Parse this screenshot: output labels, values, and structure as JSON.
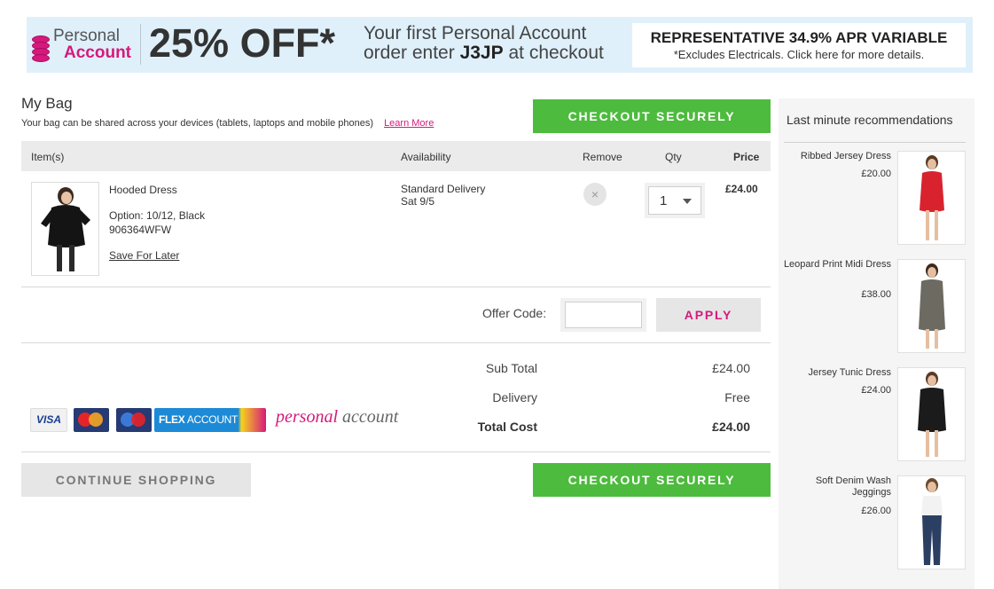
{
  "banner": {
    "logo_line1": "Personal",
    "logo_line2": "Account",
    "offer": "25% OFF*",
    "desc_line1": "Your first Personal Account",
    "desc_line2_pre": "order enter",
    "desc_code": "J3JP",
    "desc_line2_post": "at checkout",
    "apr": "REPRESENTATIVE 34.9% APR VARIABLE",
    "apr_note": "*Excludes Electricals. Click here for more details.",
    "colors": {
      "bg": "#dff0fb",
      "brand_pink": "#d6197c"
    }
  },
  "bag": {
    "title": "My Bag",
    "subtitle": "Your bag can be shared across your devices (tablets, laptops and mobile phones)",
    "learn_more": "Learn More"
  },
  "checkout_label": "CHECKOUT SECURELY",
  "table": {
    "headers": {
      "items": "Item(s)",
      "availability": "Availability",
      "remove": "Remove",
      "qty": "Qty",
      "price": "Price"
    },
    "items": [
      {
        "name": "Hooded Dress",
        "option": "Option: 10/12, Black",
        "code": "906364WFW",
        "save_for_later": "Save For Later",
        "delivery": "Standard Delivery",
        "delivery_date": "Sat 9/5",
        "remove_icon": "×",
        "qty": "1",
        "price": "£24.00"
      }
    ]
  },
  "offer": {
    "label": "Offer Code:",
    "value": "",
    "apply": "APPLY"
  },
  "totals": {
    "subtotal_label": "Sub Total",
    "subtotal": "£24.00",
    "delivery_label": "Delivery",
    "delivery": "Free",
    "total_label": "Total Cost",
    "total": "£24.00"
  },
  "payment": {
    "visa": "VISA",
    "flex_bold": "FLEX",
    "flex_rest": "ACCOUNT",
    "pa_word1": "personal",
    "pa_word2": "account"
  },
  "continue_label": "CONTINUE SHOPPING",
  "recommendations": {
    "title": "Last minute recommendations",
    "items": [
      {
        "name": "Ribbed Jersey Dress",
        "price": "£20.00",
        "color": "#d8232f"
      },
      {
        "name": "Leopard Print Midi Dress",
        "price": "£38.00",
        "color": "#6d6a62"
      },
      {
        "name": "Jersey Tunic Dress",
        "price": "£24.00",
        "color": "#1b1b1b"
      },
      {
        "name": "Soft Denim Wash Jeggings",
        "price": "£26.00",
        "color": "#2b3f63"
      }
    ]
  },
  "colors": {
    "green": "#4dbb3d",
    "pink": "#d6197c",
    "grey_btn": "#e6e6e6"
  }
}
